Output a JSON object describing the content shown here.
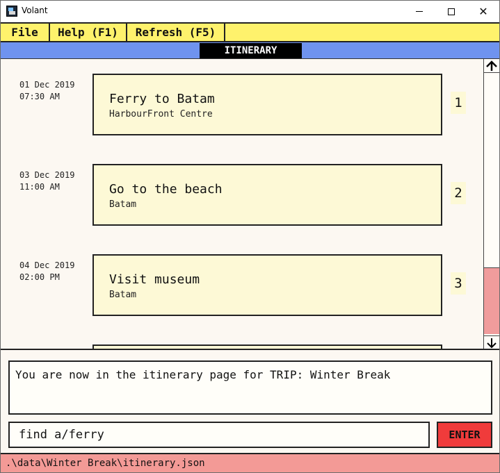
{
  "window": {
    "title": "Volant",
    "icon": "volant-app-icon",
    "controls": [
      "minimize-icon",
      "maximize-icon",
      "close-icon"
    ],
    "close_glyph": "✕"
  },
  "menu": {
    "file": "File",
    "help": "Help (F1)",
    "refresh": "Refresh (F5)"
  },
  "page": {
    "title": "ITINERARY"
  },
  "itinerary": [
    {
      "date": "01 Dec 2019",
      "time": "07:30 AM",
      "name": "Ferry to Batam",
      "location": "HarbourFront Centre",
      "index": "1"
    },
    {
      "date": "03 Dec 2019",
      "time": "11:00 AM",
      "name": "Go to the beach",
      "location": "Batam",
      "index": "2"
    },
    {
      "date": "04 Dec 2019",
      "time": "02:00 PM",
      "name": "Visit museum",
      "location": "Batam",
      "index": "3"
    }
  ],
  "scroll": {
    "up_glyph": "🡡",
    "down_glyph": "🡣",
    "up_icon": "arrow-up-icon",
    "down_icon": "arrow-down-icon"
  },
  "result": {
    "message": "You are now in the itinerary page for TRIP: Winter Break"
  },
  "command": {
    "value": "find a/ferry",
    "enter_label": "ENTER"
  },
  "status": {
    "path": ".\\data\\Winter Break\\itinerary.json"
  },
  "colors": {
    "menubar": "#fef26c",
    "pagebar": "#6f93ef",
    "card": "#fdf9d6",
    "enter": "#f03b3b",
    "statusbar": "#f39a96",
    "scroll_thumb": "#f09c9c"
  }
}
